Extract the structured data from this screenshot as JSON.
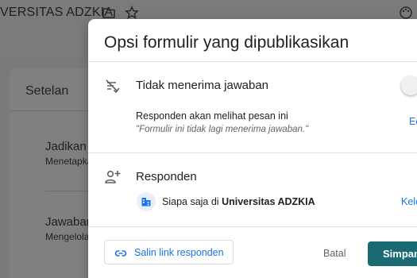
{
  "app": {
    "title": "VERSITAS ADZKIA"
  },
  "background": {
    "settings_title": "Setelan",
    "item1_title": "Jadikan i",
    "item1_sub": "Menetapka",
    "item2_title": "Jawaban",
    "item2_sub": "Mengelola"
  },
  "dialog": {
    "title": "Opsi formulir yang dipublikasikan",
    "accept": {
      "label": "Tidak menerima jawaban",
      "enabled": false,
      "message_heading": "Responden akan melihat pesan ini",
      "message_text": "\"Formulir ini tidak lagi menerima jawaban.\"",
      "edit_link": "Ec"
    },
    "responders": {
      "label": "Responden",
      "scope_prefix": "Siapa saja di",
      "scope_org": "Universitas ADZKIA",
      "manage_link": "Kelo"
    },
    "footer": {
      "copy_link_label": "Salin link responden",
      "cancel_label": "Batal",
      "save_label": "Simpan"
    }
  },
  "colors": {
    "accent_blue": "#1a73e8",
    "save_button": "#1a6a73",
    "overlay": "#7a7a7a"
  }
}
